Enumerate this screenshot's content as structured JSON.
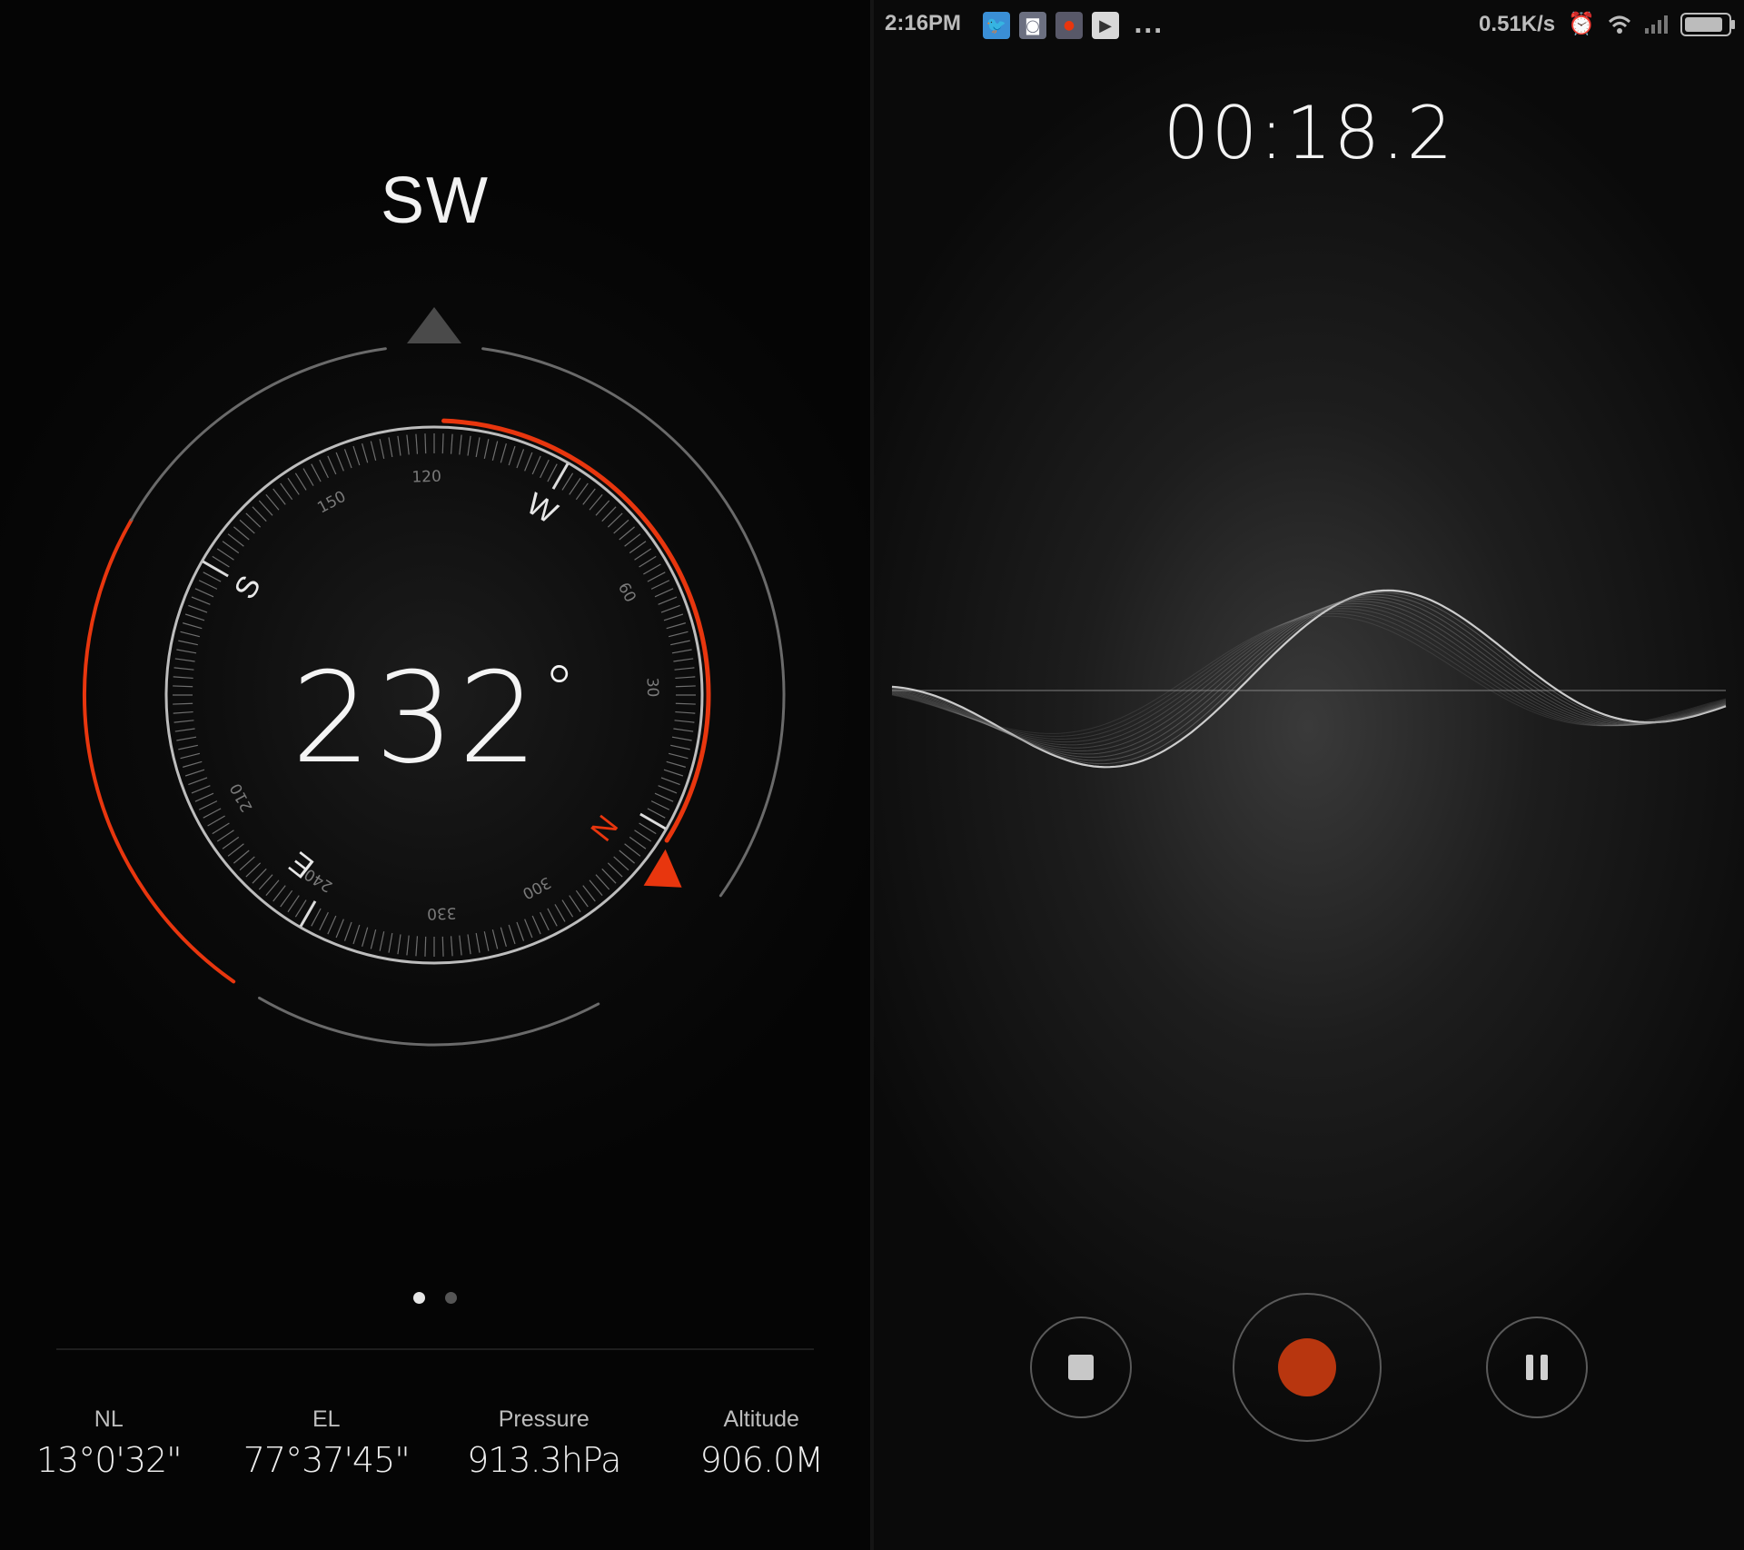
{
  "compass": {
    "direction": "SW",
    "heading_degrees": "232",
    "degree_symbol": "°",
    "dial": {
      "cardinals": [
        "S",
        "W",
        "N",
        "E"
      ],
      "ticks": [
        "120",
        "150",
        "210",
        "240",
        "300",
        "330",
        "30",
        "60"
      ]
    },
    "page_indicator": {
      "pages": 2,
      "active": 1
    },
    "stats": [
      {
        "label": "NL",
        "value": "13°0'32\""
      },
      {
        "label": "EL",
        "value": "77°37'45\""
      },
      {
        "label": "Pressure",
        "value": "913.3hPa"
      },
      {
        "label": "Altitude",
        "value": "906.0M"
      }
    ],
    "colors": {
      "accent": "#e8360e",
      "ring": "#bdbdbd"
    }
  },
  "recorder": {
    "statusbar": {
      "time": "2:16PM",
      "more": "...",
      "net_speed": "0.51K/s",
      "notification_icons": [
        "twitter-icon",
        "app-icon",
        "record-app-icon",
        "play-store-icon"
      ],
      "right_icons": [
        "alarm-off-icon",
        "wifi-icon",
        "signal-icon",
        "battery-icon"
      ],
      "battery_level": 0.9
    },
    "elapsed": "00:18.2",
    "controls": [
      "stop",
      "record",
      "pause"
    ],
    "colors": {
      "record": "#b8360f"
    }
  }
}
